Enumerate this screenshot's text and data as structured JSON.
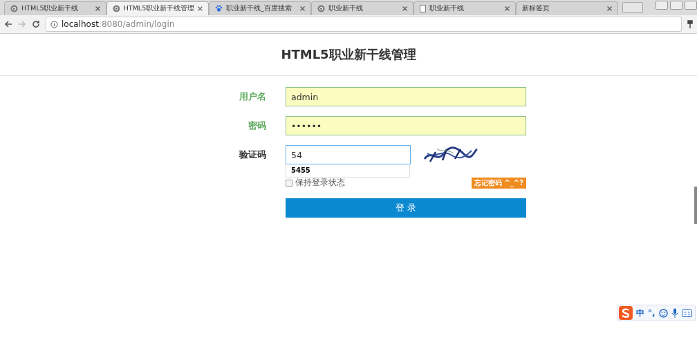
{
  "tabs": [
    {
      "label": "HTML5职业新干线",
      "selected": false
    },
    {
      "label": "HTML5职业新干线管理",
      "selected": true
    },
    {
      "label": "职业新干线_百度搜索",
      "selected": false
    },
    {
      "label": "职业新干线",
      "selected": false
    },
    {
      "label": "职业新干线",
      "selected": false
    },
    {
      "label": "新标签页",
      "selected": false
    }
  ],
  "address": {
    "host": "localhost",
    "rest": ":8080/admin/login"
  },
  "page": {
    "title": "HTML5职业新干线管理",
    "fields": [
      {
        "label": "用户名",
        "value": "admin",
        "kind": "text",
        "autofilled": true
      },
      {
        "label": "密码",
        "value": "••••••",
        "kind": "password",
        "autofilled": true
      },
      {
        "label": "验证码",
        "value": "54",
        "kind": "captcha",
        "autofilled": false,
        "suggestion": "5455"
      }
    ],
    "remember": {
      "label": "保持登录状态",
      "checked": false
    },
    "forgot": "忘记密码 ^_^?",
    "submit": "登 录"
  },
  "ime": {
    "mode": "中",
    "punct": "°,"
  }
}
